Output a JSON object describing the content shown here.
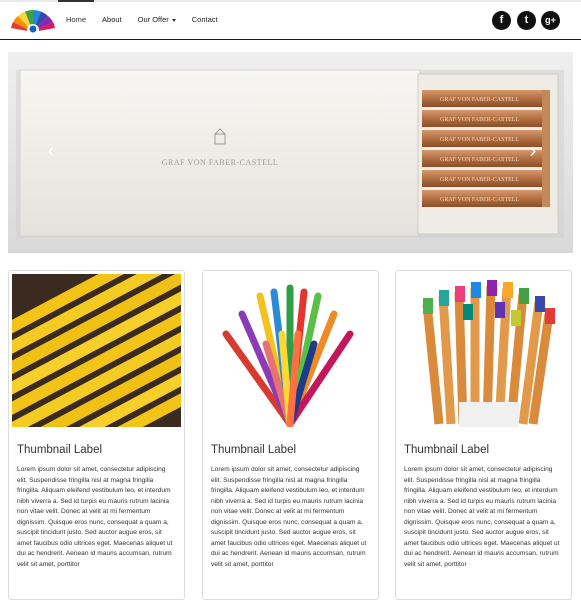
{
  "nav": {
    "logo_icon": "peacock-fan-logo-icon",
    "items": [
      {
        "label": "Home",
        "active": true
      },
      {
        "label": "About",
        "active": false
      },
      {
        "label": "Our Offer",
        "active": false,
        "dropdown": true
      },
      {
        "label": "Contact",
        "active": false
      }
    ],
    "social": [
      {
        "icon": "facebook-icon",
        "glyph": "f"
      },
      {
        "icon": "twitter-icon",
        "glyph": "t"
      },
      {
        "icon": "google-plus-icon",
        "glyph": "g+"
      }
    ]
  },
  "carousel": {
    "brand_text": "GRAF VON FABER-CASTELL",
    "pencil_text": "GRAF VON FABER-CASTELL",
    "prev_glyph": "‹",
    "next_glyph": "›",
    "slide_count": 3,
    "active_index": 0
  },
  "thumbnails": [
    {
      "image_icon": "yellow-pencils-image",
      "label": "Thumbnail Label",
      "text": "Lorem ipsum dolor sit amet, consectetur adipiscing elit. Suspendisse fringilla nisl at magna fringilla fringilla. Aliquam eleifend vestibulum leo, et interdum nibh viverra a. Sed id turpis eu mauris rutrum lacinia non vitae velit. Donec at velit at mi fermentum dignissim. Quisque eros nunc, consequat a quam a, suscipit tincidunt justo. Sed auctor augue eros, sit amet faucibus odio ultrices eget. Maecenas aliquet ut dui ac hendrerit. Aenean id mauris accumsan, rutrum velit sit amet, porttitor"
    },
    {
      "image_icon": "colored-pencils-image",
      "label": "Thumbnail Label",
      "text": "Lorem ipsum dolor sit amet, consectetur adipiscing elit. Suspendisse fringilla nisl at magna fringilla fringilla. Aliquam eleifend vestibulum leo, et interdum nibh viverra a. Sed id turpis eu mauris rutrum lacinia non vitae velit. Donec at velit at mi fermentum dignissim. Quisque eros nunc, consequat a quam a, suscipit tincidunt justo. Sed auctor augue eros, sit amet faucibus odio ultrices eget. Maecenas aliquet ut dui ac hendrerit. Aenean id mauris accumsan, rutrum velit sit amet, porttitor"
    },
    {
      "image_icon": "markers-in-cup-image",
      "label": "Thumbnail Label",
      "text": "Lorem ipsum dolor sit amet, consectetur adipiscing elit. Suspendisse fringilla nisl at magna fringilla fringilla. Aliquam eleifend vestibulum leo, et interdum nibh viverra a. Sed id turpis eu mauris rutrum lacinia non vitae velit. Donec at velit at mi fermentum dignissim. Quisque eros nunc, consequat a quam a, suscipit tincidunt justo. Sed auctor augue eros, sit amet faucibus odio ultrices eget. Maecenas aliquet ut dui ac hendrerit. Aenean id mauris accumsan, rutrum velit sit amet, porttitor"
    }
  ]
}
